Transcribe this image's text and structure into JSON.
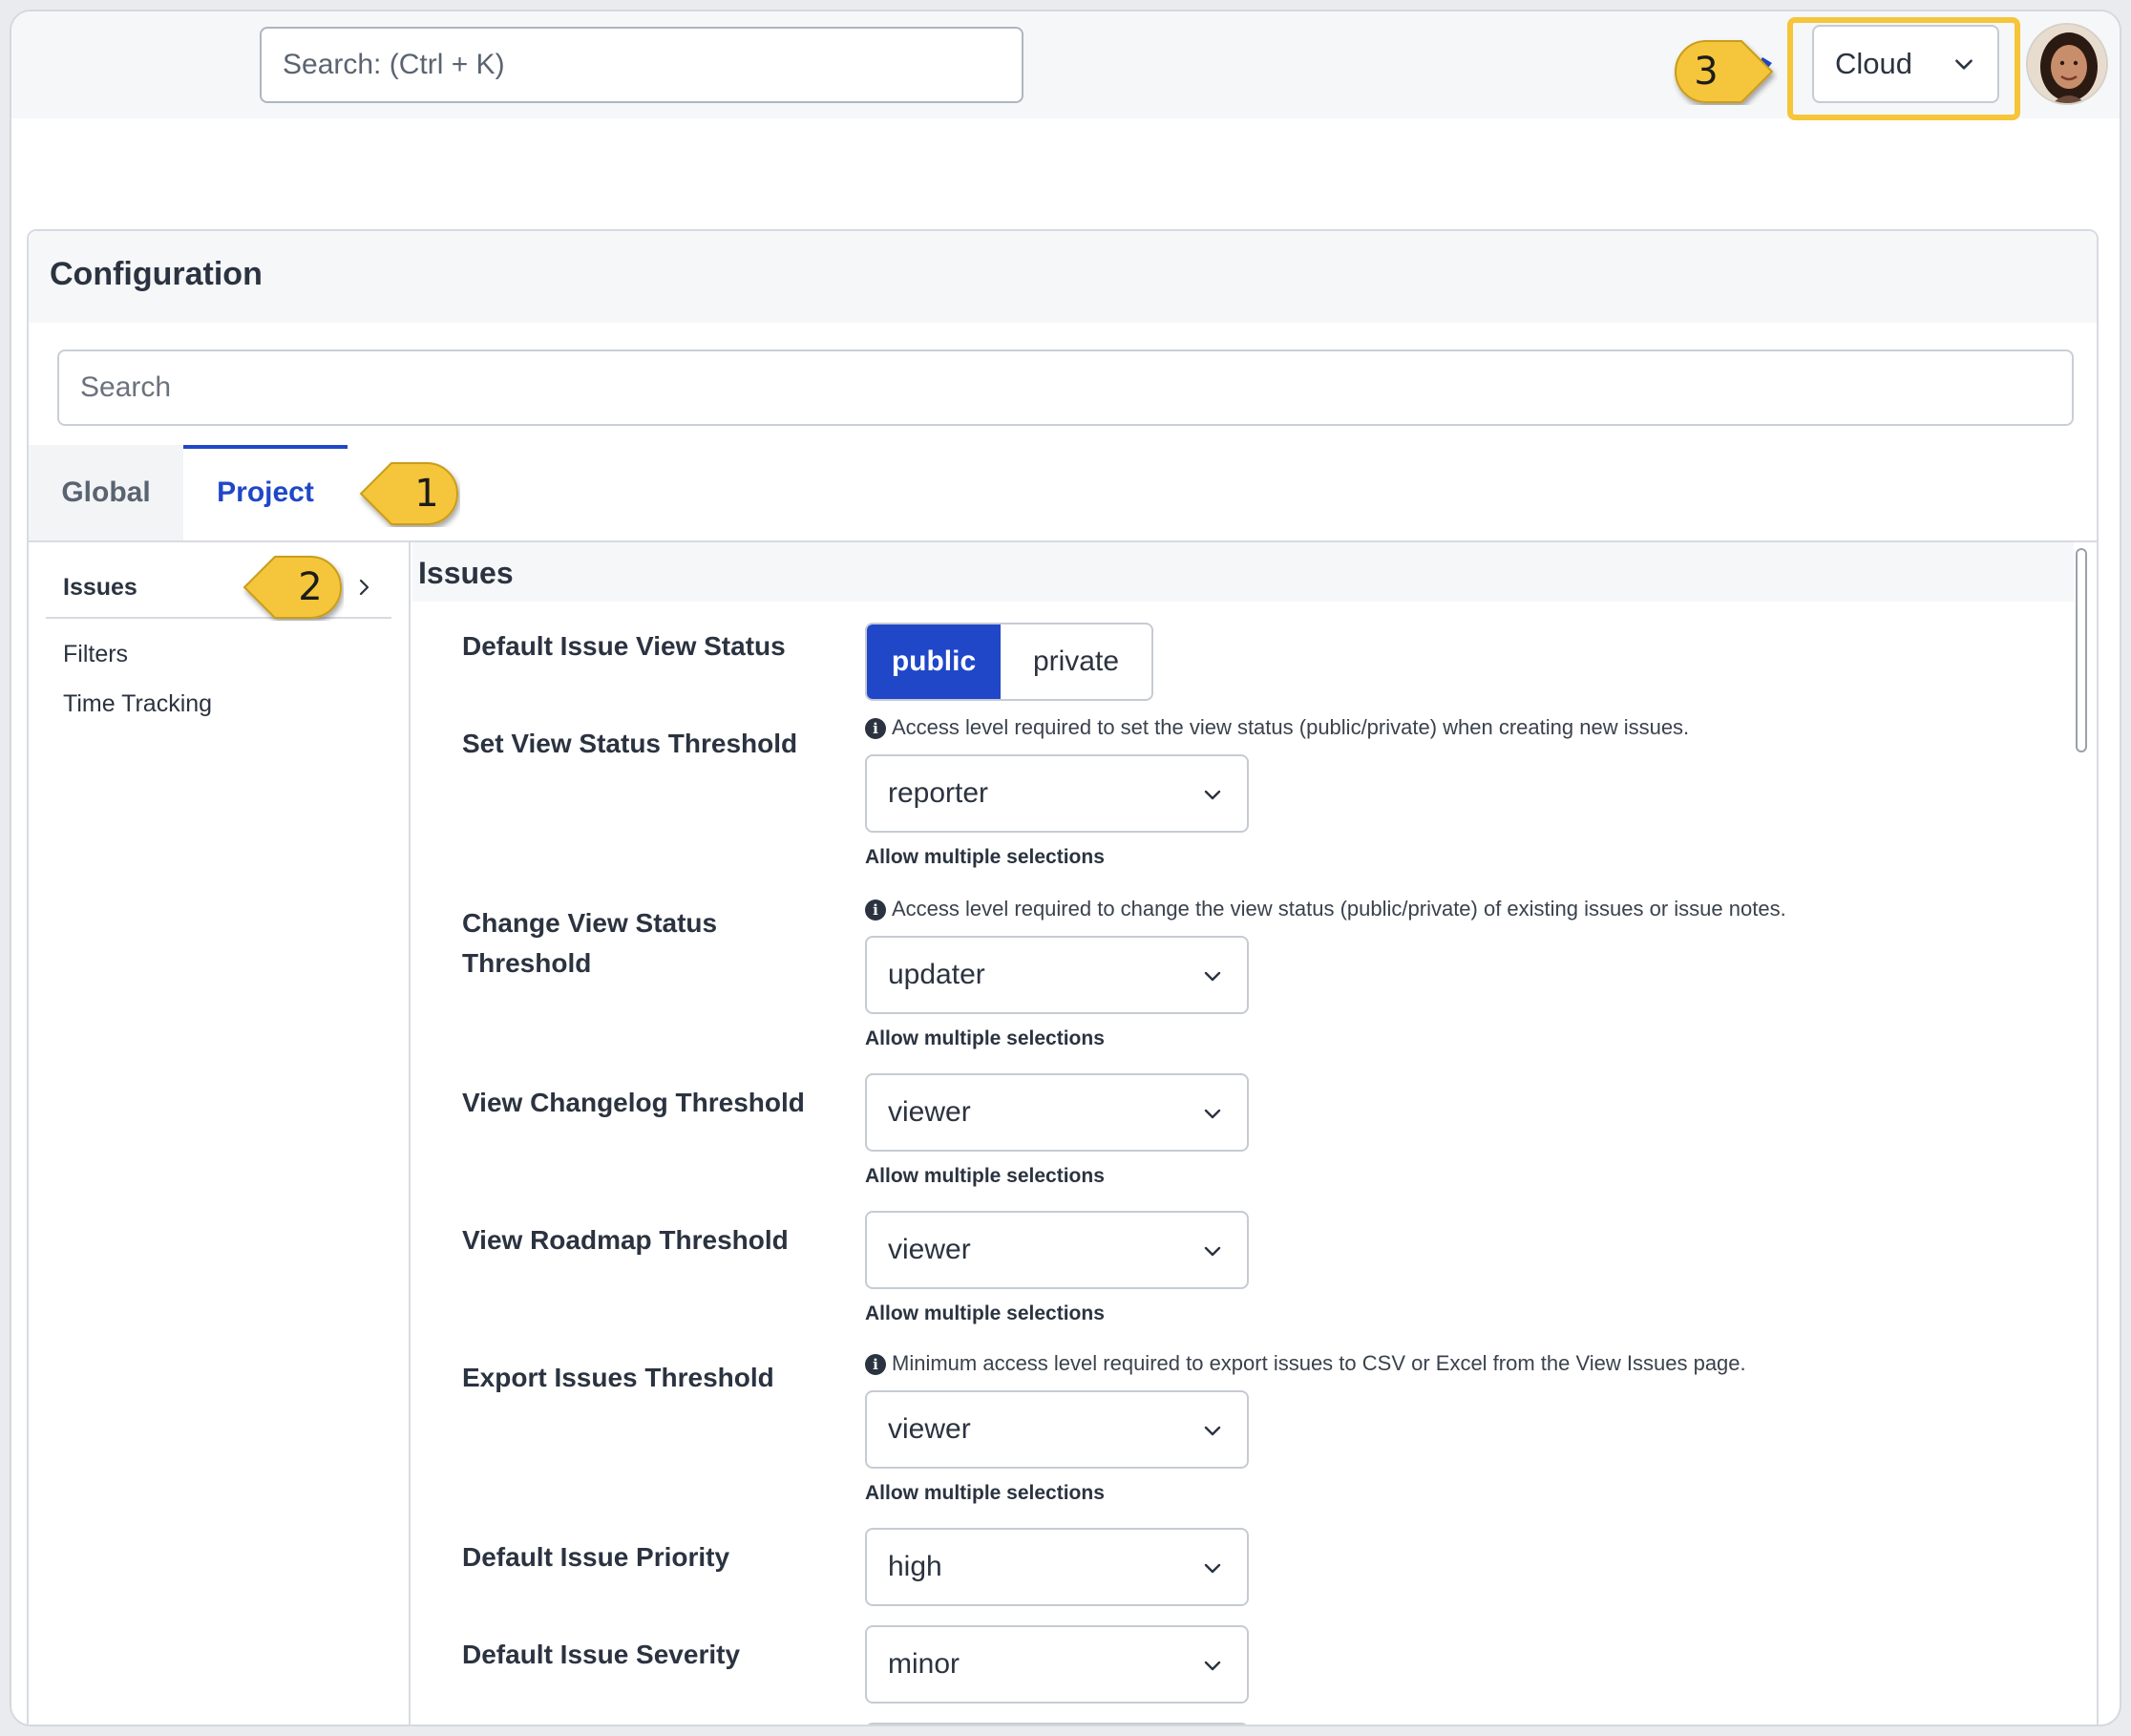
{
  "topbar": {
    "search_placeholder": "Search: (Ctrl + K)",
    "project_select": {
      "value": "Cloud"
    }
  },
  "callouts": [
    "1",
    "2",
    "3"
  ],
  "config": {
    "title": "Configuration",
    "search_placeholder": "Search",
    "tabs": [
      {
        "label": "Global",
        "active": false
      },
      {
        "label": "Project",
        "active": true
      }
    ]
  },
  "sidebar": {
    "items": [
      {
        "label": "Issues",
        "active": true
      },
      {
        "label": "Filters",
        "active": false
      },
      {
        "label": "Time Tracking",
        "active": false
      }
    ]
  },
  "main": {
    "title": "Issues",
    "allow_multiple": "Allow multiple selections",
    "default_view_status": {
      "label": "Default Issue View Status",
      "options": [
        "public",
        "private"
      ],
      "selected": "public"
    },
    "set_view_status": {
      "label": "Set View Status Threshold",
      "hint": "Access level required to set the view status (public/private) when creating new issues.",
      "value": "reporter"
    },
    "change_view_status": {
      "label_line1": "Change View Status",
      "label_line2": "Threshold",
      "hint": "Access level required to change the view status (public/private) of existing issues or issue notes.",
      "value": "updater"
    },
    "view_changelog": {
      "label": "View Changelog Threshold",
      "value": "viewer"
    },
    "view_roadmap": {
      "label": "View Roadmap Threshold",
      "value": "viewer"
    },
    "export_issues": {
      "label": "Export Issues Threshold",
      "hint": "Minimum access level required to export issues to CSV or Excel from the View Issues page.",
      "value": "viewer"
    },
    "default_priority": {
      "label": "Default Issue Priority",
      "value": "high"
    },
    "default_severity": {
      "label": "Default Issue Severity",
      "value": "minor"
    }
  },
  "colors": {
    "accent": "#1f47c8",
    "callout": "#f5c53a",
    "border": "#c6cbd3"
  }
}
